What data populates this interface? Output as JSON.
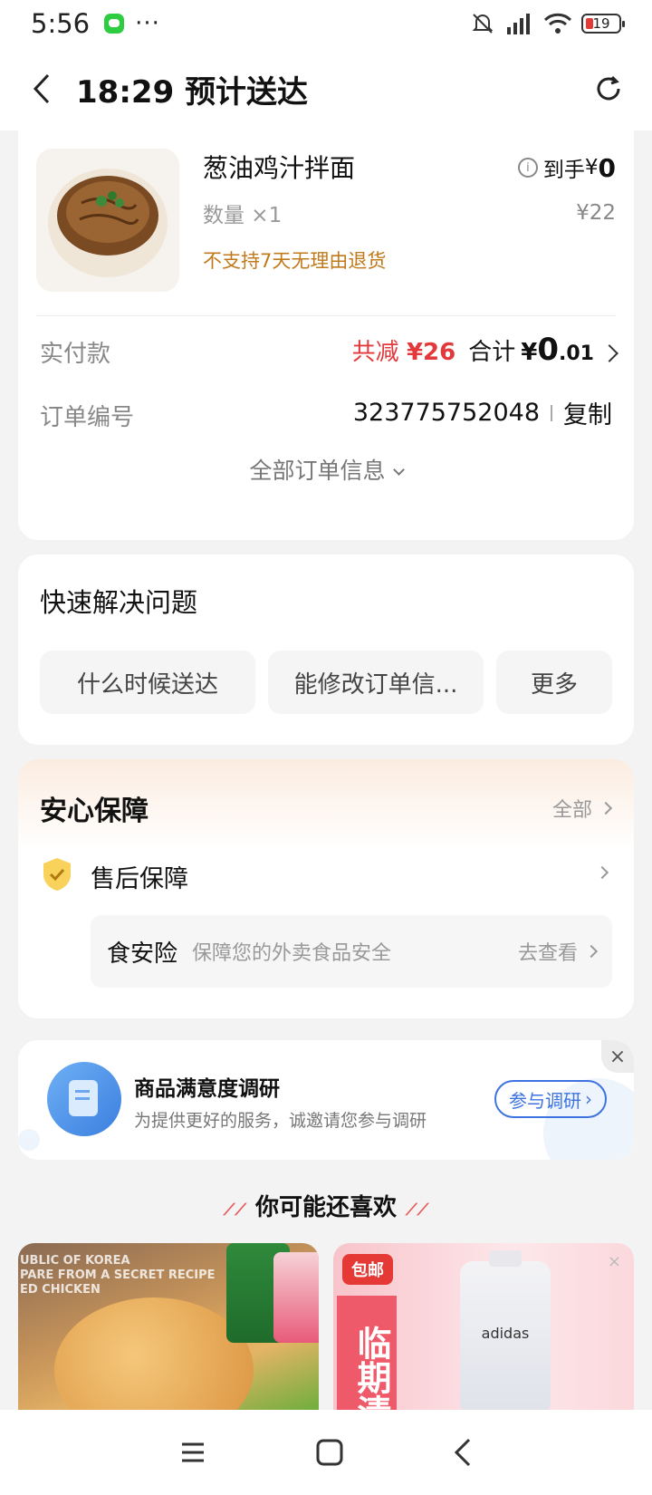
{
  "status_bar": {
    "time": "5:56",
    "dots": "···",
    "battery": "19"
  },
  "header": {
    "title": "18:29 预计送达"
  },
  "order": {
    "item_name": "葱油鸡汁拌面",
    "quantity": "数量 ×1",
    "note": "不支持7天无理由退货",
    "net_label": "到手",
    "net_symbol": "¥",
    "net_amount": "0",
    "original_price": "¥22",
    "paid_label": "实付款",
    "discount_label": "共减",
    "discount_value": "¥26",
    "total_label": "合计",
    "total_symbol": "¥",
    "total_main": "0",
    "total_decimal": ".01",
    "order_no_label": "订单编号",
    "order_no": "323775752048",
    "copy_label": "复制",
    "all_info": "全部订单信息"
  },
  "quick": {
    "title": "快速解决问题",
    "buttons": [
      "什么时候送达",
      "能修改订单信...",
      "更多"
    ]
  },
  "safety": {
    "title": "安心保障",
    "all": "全部",
    "after_sale": "售后保障",
    "insurance_name": "食安险",
    "insurance_desc": "保障您的外卖食品安全",
    "insurance_go": "去查看"
  },
  "survey": {
    "title": "商品满意度调研",
    "subtitle": "为提供更好的服务，诚邀请您参与调研",
    "button": "参与调研",
    "close": "×"
  },
  "recommend": {
    "title": "你可能还喜欢",
    "item1_text": "UBLIC OF KOREA\nPARE FROM A SECRET RECIPE\nED CHICKEN",
    "item2_badge": "包邮",
    "item2_vertical": "临期清",
    "item2_brand": "adidas",
    "item2_close": "×"
  },
  "colors": {
    "accent_red": "#e4393c",
    "orange_note": "#c07a1c",
    "link_blue": "#3c73e0"
  }
}
